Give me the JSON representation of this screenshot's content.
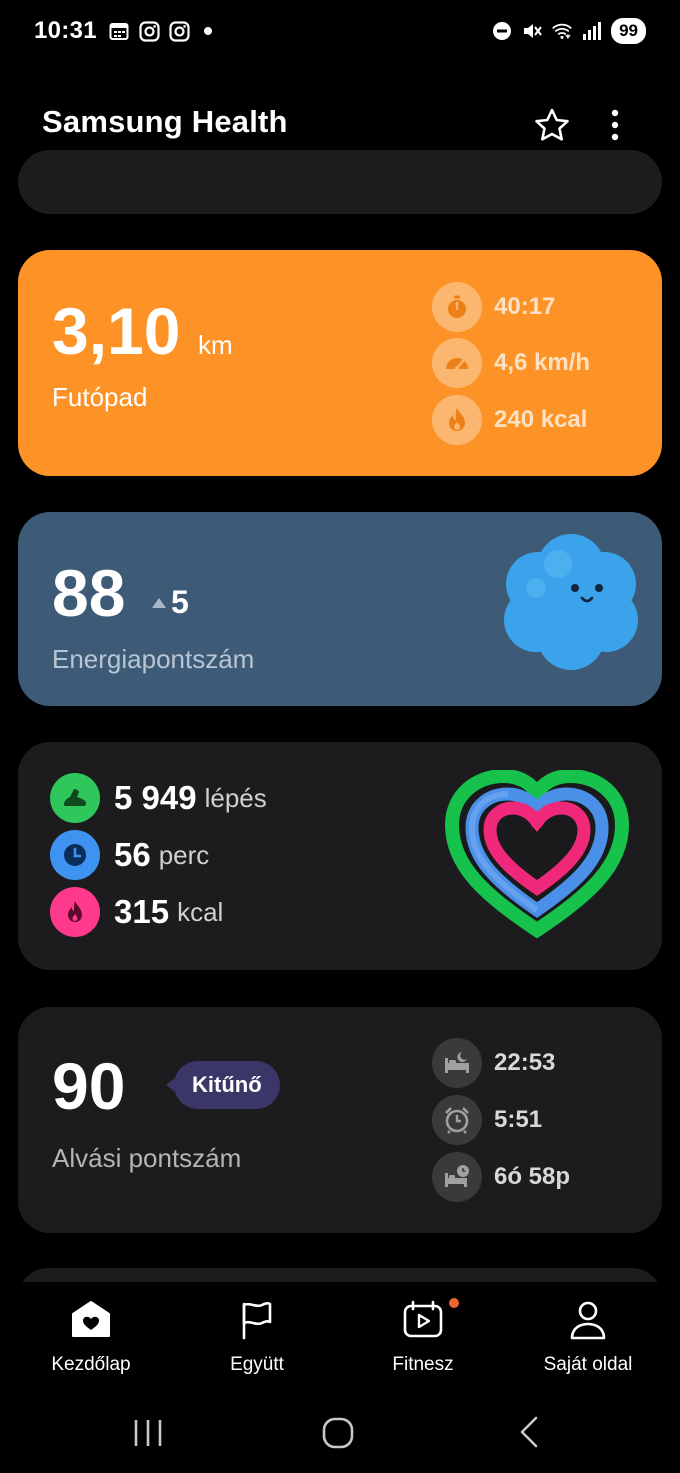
{
  "status_bar": {
    "time": "10:31",
    "battery": "99",
    "left_icons": [
      "calendar-icon",
      "instagram-icon",
      "instagram-icon",
      "dot"
    ],
    "right_icons": [
      "dnd-icon",
      "mute-icon",
      "wifi-icon",
      "signal-icon"
    ]
  },
  "header": {
    "title": "Samsung Health"
  },
  "treadmill": {
    "distance": "3,10",
    "unit": "km",
    "label": "Futópad",
    "stats": {
      "duration": "40:17",
      "speed": "4,6  km/h",
      "calories": "240  kcal"
    },
    "color": "#fd9327"
  },
  "energy": {
    "score": "88",
    "change": "5",
    "label": "Energiapontszám",
    "color": "#3d5a77"
  },
  "activity": {
    "steps_value": "5 949",
    "steps_unit": "lépés",
    "minutes_value": "56",
    "minutes_unit": "perc",
    "kcal_value": "315",
    "kcal_unit": "kcal",
    "colors": {
      "steps": "#2fc75c",
      "minutes": "#3e92f0",
      "kcal": "#ff3a8c"
    }
  },
  "sleep": {
    "score": "90",
    "badge": "Kitűnő",
    "label": "Alvási pontszám",
    "stats": {
      "bedtime": "22:53",
      "wake": "5:51",
      "duration": "6ó 58p"
    }
  },
  "bottom_nav": {
    "items": [
      {
        "label": "Kezdőlap",
        "icon": "home-icon"
      },
      {
        "label": "Együtt",
        "icon": "flag-icon"
      },
      {
        "label": "Fitnesz",
        "icon": "fitness-video-icon"
      },
      {
        "label": "Saját oldal",
        "icon": "person-icon"
      }
    ]
  }
}
